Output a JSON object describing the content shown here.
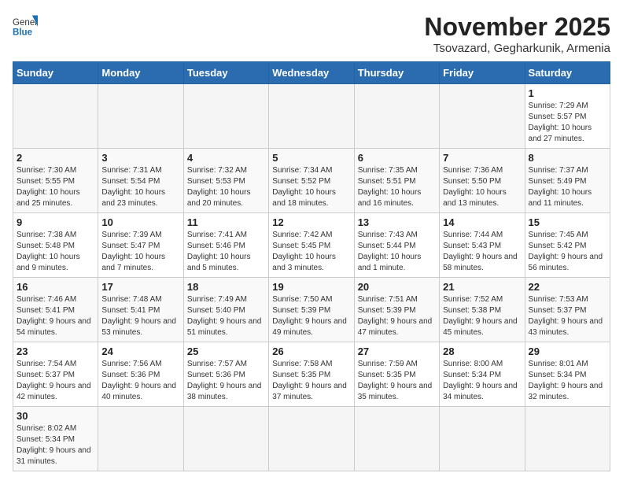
{
  "header": {
    "logo_general": "General",
    "logo_blue": "Blue",
    "month_title": "November 2025",
    "location": "Tsovazard, Gegharkunik, Armenia"
  },
  "weekdays": [
    "Sunday",
    "Monday",
    "Tuesday",
    "Wednesday",
    "Thursday",
    "Friday",
    "Saturday"
  ],
  "weeks": [
    [
      {
        "day": "",
        "info": ""
      },
      {
        "day": "",
        "info": ""
      },
      {
        "day": "",
        "info": ""
      },
      {
        "day": "",
        "info": ""
      },
      {
        "day": "",
        "info": ""
      },
      {
        "day": "",
        "info": ""
      },
      {
        "day": "1",
        "info": "Sunrise: 7:29 AM\nSunset: 5:57 PM\nDaylight: 10 hours and 27 minutes."
      }
    ],
    [
      {
        "day": "2",
        "info": "Sunrise: 7:30 AM\nSunset: 5:55 PM\nDaylight: 10 hours and 25 minutes."
      },
      {
        "day": "3",
        "info": "Sunrise: 7:31 AM\nSunset: 5:54 PM\nDaylight: 10 hours and 23 minutes."
      },
      {
        "day": "4",
        "info": "Sunrise: 7:32 AM\nSunset: 5:53 PM\nDaylight: 10 hours and 20 minutes."
      },
      {
        "day": "5",
        "info": "Sunrise: 7:34 AM\nSunset: 5:52 PM\nDaylight: 10 hours and 18 minutes."
      },
      {
        "day": "6",
        "info": "Sunrise: 7:35 AM\nSunset: 5:51 PM\nDaylight: 10 hours and 16 minutes."
      },
      {
        "day": "7",
        "info": "Sunrise: 7:36 AM\nSunset: 5:50 PM\nDaylight: 10 hours and 13 minutes."
      },
      {
        "day": "8",
        "info": "Sunrise: 7:37 AM\nSunset: 5:49 PM\nDaylight: 10 hours and 11 minutes."
      }
    ],
    [
      {
        "day": "9",
        "info": "Sunrise: 7:38 AM\nSunset: 5:48 PM\nDaylight: 10 hours and 9 minutes."
      },
      {
        "day": "10",
        "info": "Sunrise: 7:39 AM\nSunset: 5:47 PM\nDaylight: 10 hours and 7 minutes."
      },
      {
        "day": "11",
        "info": "Sunrise: 7:41 AM\nSunset: 5:46 PM\nDaylight: 10 hours and 5 minutes."
      },
      {
        "day": "12",
        "info": "Sunrise: 7:42 AM\nSunset: 5:45 PM\nDaylight: 10 hours and 3 minutes."
      },
      {
        "day": "13",
        "info": "Sunrise: 7:43 AM\nSunset: 5:44 PM\nDaylight: 10 hours and 1 minute."
      },
      {
        "day": "14",
        "info": "Sunrise: 7:44 AM\nSunset: 5:43 PM\nDaylight: 9 hours and 58 minutes."
      },
      {
        "day": "15",
        "info": "Sunrise: 7:45 AM\nSunset: 5:42 PM\nDaylight: 9 hours and 56 minutes."
      }
    ],
    [
      {
        "day": "16",
        "info": "Sunrise: 7:46 AM\nSunset: 5:41 PM\nDaylight: 9 hours and 54 minutes."
      },
      {
        "day": "17",
        "info": "Sunrise: 7:48 AM\nSunset: 5:41 PM\nDaylight: 9 hours and 53 minutes."
      },
      {
        "day": "18",
        "info": "Sunrise: 7:49 AM\nSunset: 5:40 PM\nDaylight: 9 hours and 51 minutes."
      },
      {
        "day": "19",
        "info": "Sunrise: 7:50 AM\nSunset: 5:39 PM\nDaylight: 9 hours and 49 minutes."
      },
      {
        "day": "20",
        "info": "Sunrise: 7:51 AM\nSunset: 5:39 PM\nDaylight: 9 hours and 47 minutes."
      },
      {
        "day": "21",
        "info": "Sunrise: 7:52 AM\nSunset: 5:38 PM\nDaylight: 9 hours and 45 minutes."
      },
      {
        "day": "22",
        "info": "Sunrise: 7:53 AM\nSunset: 5:37 PM\nDaylight: 9 hours and 43 minutes."
      }
    ],
    [
      {
        "day": "23",
        "info": "Sunrise: 7:54 AM\nSunset: 5:37 PM\nDaylight: 9 hours and 42 minutes."
      },
      {
        "day": "24",
        "info": "Sunrise: 7:56 AM\nSunset: 5:36 PM\nDaylight: 9 hours and 40 minutes."
      },
      {
        "day": "25",
        "info": "Sunrise: 7:57 AM\nSunset: 5:36 PM\nDaylight: 9 hours and 38 minutes."
      },
      {
        "day": "26",
        "info": "Sunrise: 7:58 AM\nSunset: 5:35 PM\nDaylight: 9 hours and 37 minutes."
      },
      {
        "day": "27",
        "info": "Sunrise: 7:59 AM\nSunset: 5:35 PM\nDaylight: 9 hours and 35 minutes."
      },
      {
        "day": "28",
        "info": "Sunrise: 8:00 AM\nSunset: 5:34 PM\nDaylight: 9 hours and 34 minutes."
      },
      {
        "day": "29",
        "info": "Sunrise: 8:01 AM\nSunset: 5:34 PM\nDaylight: 9 hours and 32 minutes."
      }
    ],
    [
      {
        "day": "30",
        "info": "Sunrise: 8:02 AM\nSunset: 5:34 PM\nDaylight: 9 hours and 31 minutes."
      },
      {
        "day": "",
        "info": ""
      },
      {
        "day": "",
        "info": ""
      },
      {
        "day": "",
        "info": ""
      },
      {
        "day": "",
        "info": ""
      },
      {
        "day": "",
        "info": ""
      },
      {
        "day": "",
        "info": ""
      }
    ]
  ]
}
